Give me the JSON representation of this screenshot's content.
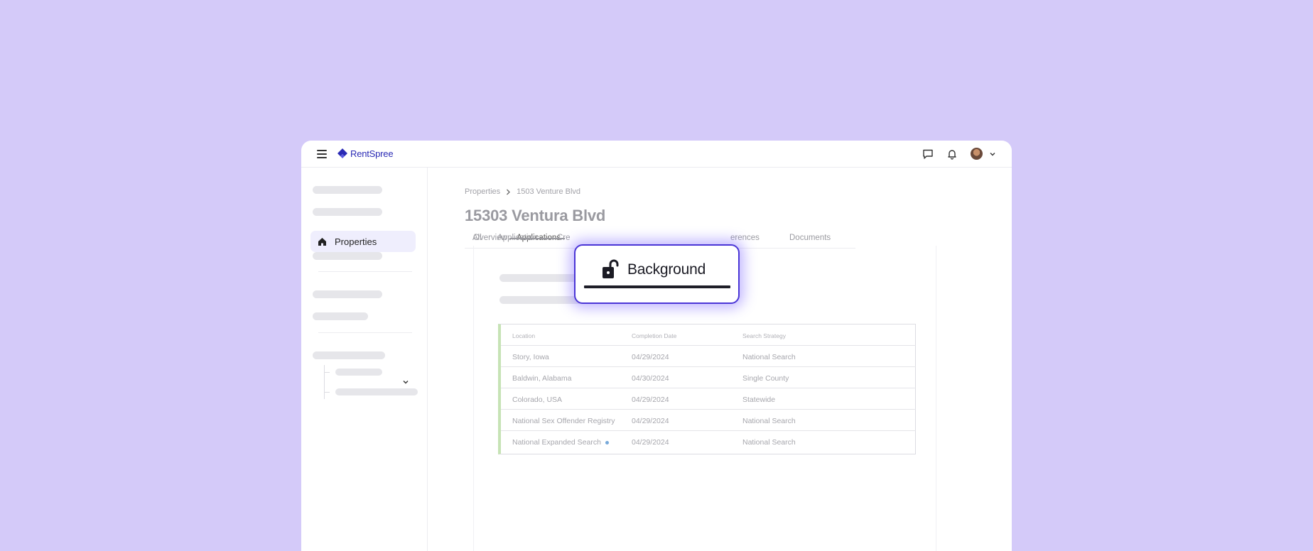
{
  "app": {
    "brand": "RentSpree",
    "colors": {
      "background": "#d4caf9",
      "brand": "#2b2bb5",
      "accent": "#4a35d6",
      "table_bar": "#c6e3b5"
    }
  },
  "topbar": {
    "menu_icon": "hamburger-icon",
    "icons": [
      "chat-icon",
      "bell-icon",
      "avatar",
      "chevron-down-icon"
    ]
  },
  "sidebar": {
    "active_item": {
      "label": "Properties",
      "icon": "home-icon"
    }
  },
  "breadcrumb": {
    "root": "Properties",
    "current": "1503 Venture Blvd"
  },
  "page": {
    "title": "15303 Ventura Blvd"
  },
  "tabs": {
    "primary": [
      "Overview",
      "Applications"
    ],
    "active": "Applications",
    "secondary": [
      "All",
      "Application",
      "Cre",
      "erences",
      "Documents"
    ]
  },
  "popup": {
    "label": "Background",
    "icon": "unlock-icon"
  },
  "table": {
    "headers": [
      "Location",
      "Completion Date",
      "Search Strategy"
    ],
    "rows": [
      [
        "Story, Iowa",
        "04/29/2024",
        "National Search"
      ],
      [
        "Baldwin, Alabama",
        "04/30/2024",
        "Single County"
      ],
      [
        "Colorado, USA",
        "04/29/2024",
        "Statewide"
      ],
      [
        "National Sex Offender Registry",
        "04/29/2024",
        "National Search"
      ],
      [
        "National Expanded Search",
        "04/29/2024",
        "National Search"
      ]
    ]
  }
}
